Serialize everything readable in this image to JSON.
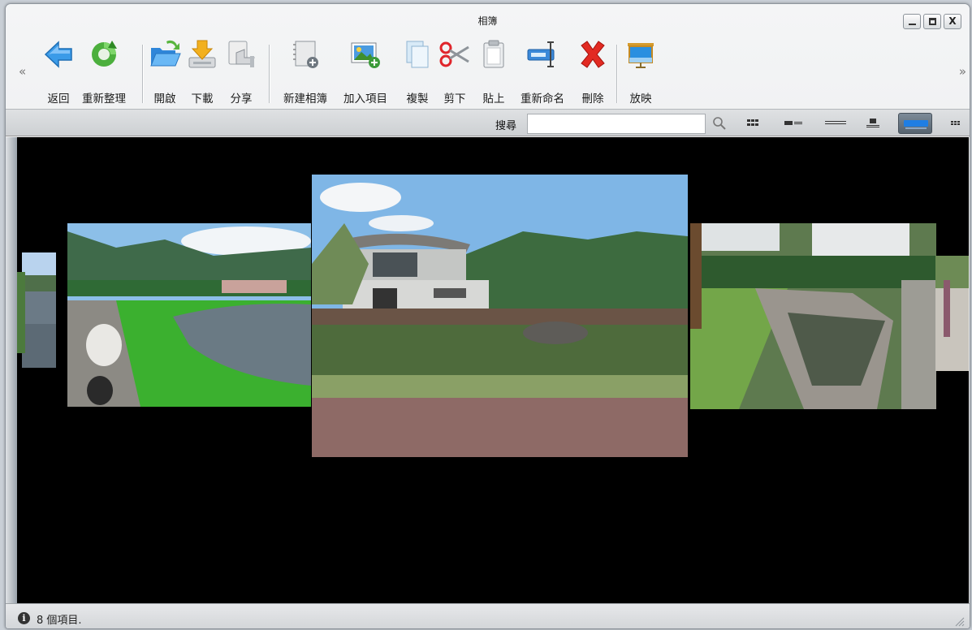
{
  "window": {
    "title": "相簿",
    "min_glyph": "_",
    "max_glyph": "□",
    "close_glyph": "X"
  },
  "toolbar": {
    "nav_left": "«",
    "nav_right": "»",
    "back": "返回",
    "refresh": "重新整理",
    "open": "開啟",
    "download": "下載",
    "share": "分享",
    "new_album": "新建相簿",
    "add_item": "加入項目",
    "copy": "複製",
    "cut": "剪下",
    "paste": "貼上",
    "rename": "重新命名",
    "delete": "刪除",
    "slideshow": "放映"
  },
  "search": {
    "label": "搜尋",
    "placeholder": ""
  },
  "views": {
    "items": [
      "grid-view",
      "detail-view",
      "list-view",
      "tile-view",
      "coverflow-view",
      "small-grid-view"
    ],
    "active": "coverflow-view"
  },
  "status": {
    "text": "8 個項目."
  },
  "colors": {
    "active_view": "#5a6775",
    "background": "#000000"
  }
}
